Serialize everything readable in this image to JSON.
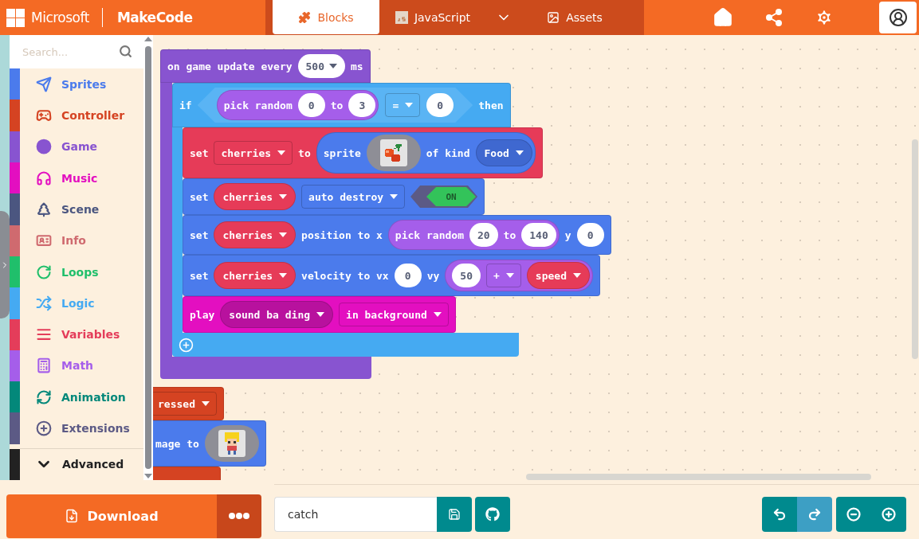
{
  "header": {
    "brand": "Microsoft",
    "app": "MakeCode",
    "tabs": [
      {
        "label": "Blocks",
        "kind": "blocks",
        "selected": true
      },
      {
        "label": "JavaScript",
        "kind": "javascript",
        "selected": false
      },
      {
        "label": "Assets",
        "kind": "assets",
        "selected": false
      }
    ],
    "actions": [
      {
        "kind": "home"
      },
      {
        "kind": "share"
      },
      {
        "kind": "settings"
      }
    ]
  },
  "toolbox": {
    "placeholder": "Search...",
    "categories": [
      {
        "label": "Sprites",
        "kind": "sprites",
        "color": "#4b7bec"
      },
      {
        "label": "Controller",
        "kind": "controller",
        "color": "#d54322"
      },
      {
        "label": "Game",
        "kind": "game",
        "color": "#8854d0"
      },
      {
        "label": "Music",
        "kind": "music",
        "color": "#e30fc0"
      },
      {
        "label": "Scene",
        "kind": "scene",
        "color": "#4b5680"
      },
      {
        "label": "Info",
        "kind": "info",
        "color": "#cf6a6f"
      },
      {
        "label": "Loops",
        "kind": "loops",
        "color": "#20bf6b"
      },
      {
        "label": "Logic",
        "kind": "logic",
        "color": "#45aaf2"
      },
      {
        "label": "Variables",
        "kind": "variables",
        "color": "#e43d5a"
      },
      {
        "label": "Math",
        "kind": "math",
        "color": "#a55eea"
      },
      {
        "label": "Animation",
        "kind": "animation",
        "color": "#03887a"
      },
      {
        "label": "Extensions",
        "kind": "extensions",
        "color": "#5c5a85"
      }
    ],
    "advanced": "Advanced"
  },
  "workspace": {
    "event": {
      "kind": "event",
      "color": "#8854d0",
      "head": [
        {
          "kind": "label",
          "text": "on game update every"
        },
        {
          "kind": "number-drop",
          "text": "500"
        },
        {
          "kind": "label",
          "text": "ms"
        }
      ],
      "body": [
        {
          "kind": "if",
          "color": "#45aaf2",
          "head": [
            {
              "kind": "label",
              "text": "if"
            },
            {
              "kind": "hexagon",
              "items": [
                {
                  "kind": "reporter",
                  "color": "#a55eea",
                  "items": [
                    {
                      "kind": "label",
                      "text": "pick random"
                    },
                    {
                      "kind": "number",
                      "text": "0"
                    },
                    {
                      "kind": "label",
                      "text": "to"
                    },
                    {
                      "kind": "number",
                      "text": "3"
                    }
                  ]
                },
                {
                  "kind": "drop",
                  "text": "="
                },
                {
                  "kind": "number",
                  "text": "0"
                }
              ]
            },
            {
              "kind": "label",
              "text": "then"
            }
          ],
          "body": [
            {
              "kind": "statement",
              "color": "#e63b58",
              "head": [
                {
                  "kind": "label",
                  "text": "set"
                },
                {
                  "kind": "drop",
                  "text": "cherries"
                },
                {
                  "kind": "label",
                  "text": "to"
                },
                {
                  "kind": "reporter",
                  "color": "#4b7bec",
                  "items": [
                    {
                      "kind": "label",
                      "text": "sprite"
                    },
                    {
                      "kind": "image-cherries"
                    },
                    {
                      "kind": "label",
                      "text": "of kind"
                    },
                    {
                      "kind": "pill-drop",
                      "text": "Food",
                      "color": "#3f68d0"
                    }
                  ]
                }
              ]
            },
            {
              "kind": "statement",
              "color": "#4b7bec",
              "head": [
                {
                  "kind": "label",
                  "text": "set"
                },
                {
                  "kind": "pill-drop",
                  "text": "cherries",
                  "color": "#e63b58"
                },
                {
                  "kind": "drop",
                  "text": "auto destroy"
                },
                {
                  "kind": "toggle",
                  "text": "ON",
                  "on": true
                }
              ]
            },
            {
              "kind": "statement",
              "color": "#4b7bec",
              "head": [
                {
                  "kind": "label",
                  "text": "set"
                },
                {
                  "kind": "pill-drop",
                  "text": "cherries",
                  "color": "#e63b58"
                },
                {
                  "kind": "label",
                  "text": "position to x"
                },
                {
                  "kind": "reporter",
                  "color": "#a55eea",
                  "items": [
                    {
                      "kind": "label",
                      "text": "pick random"
                    },
                    {
                      "kind": "number",
                      "text": "20"
                    },
                    {
                      "kind": "label",
                      "text": "to"
                    },
                    {
                      "kind": "number",
                      "text": "140"
                    }
                  ]
                },
                {
                  "kind": "label",
                  "text": "y"
                },
                {
                  "kind": "number",
                  "text": "0"
                }
              ]
            },
            {
              "kind": "statement",
              "color": "#4b7bec",
              "head": [
                {
                  "kind": "label",
                  "text": "set"
                },
                {
                  "kind": "pill-drop",
                  "text": "cherries",
                  "color": "#e63b58"
                },
                {
                  "kind": "label",
                  "text": "velocity to vx"
                },
                {
                  "kind": "number",
                  "text": "0"
                },
                {
                  "kind": "label",
                  "text": "vy"
                },
                {
                  "kind": "reporter",
                  "color": "#a55eea",
                  "items": [
                    {
                      "kind": "number",
                      "text": "50"
                    },
                    {
                      "kind": "drop",
                      "text": "+"
                    },
                    {
                      "kind": "pill-drop",
                      "text": "speed",
                      "color": "#e63b58"
                    }
                  ]
                }
              ]
            },
            {
              "kind": "statement",
              "color": "#e30fc0",
              "head": [
                {
                  "kind": "label",
                  "text": "play"
                },
                {
                  "kind": "pill-drop",
                  "text": "sound ba ding",
                  "color": "#b8119e"
                },
                {
                  "kind": "drop",
                  "text": "in background"
                }
              ]
            }
          ]
        }
      ]
    },
    "fragments": [
      {
        "color": "#d54322",
        "head": [
          {
            "kind": "drop",
            "text": "ressed"
          }
        ]
      },
      {
        "color": "#4b7bec",
        "head": [
          {
            "kind": "label",
            "text": "mage to"
          },
          {
            "kind": "image-girl"
          }
        ]
      },
      {
        "color": "#d54322"
      }
    ]
  },
  "footer": {
    "download": "Download",
    "project_name": "catch"
  }
}
